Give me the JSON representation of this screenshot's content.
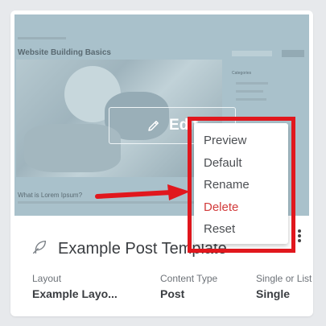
{
  "card": {
    "preview": {
      "page_title": "Website Building Basics",
      "sub_title": "What is Lorem Ipsum?",
      "sidebar_heading": "Categories"
    },
    "edit_button_label": "Edit",
    "context_menu": {
      "items": [
        {
          "label": "Preview"
        },
        {
          "label": "Default"
        },
        {
          "label": "Rename"
        },
        {
          "label": "Delete"
        },
        {
          "label": "Reset"
        }
      ]
    },
    "title": "Example Post Template",
    "meta": [
      {
        "label": "Layout",
        "value": "Example Layo..."
      },
      {
        "label": "Content Type",
        "value": "Post"
      },
      {
        "label": "Single or List",
        "value": "Single"
      }
    ]
  },
  "colors": {
    "highlight_box": "#e1171d",
    "danger_text": "#d23b3b",
    "overlay": "#a9c1cb"
  }
}
